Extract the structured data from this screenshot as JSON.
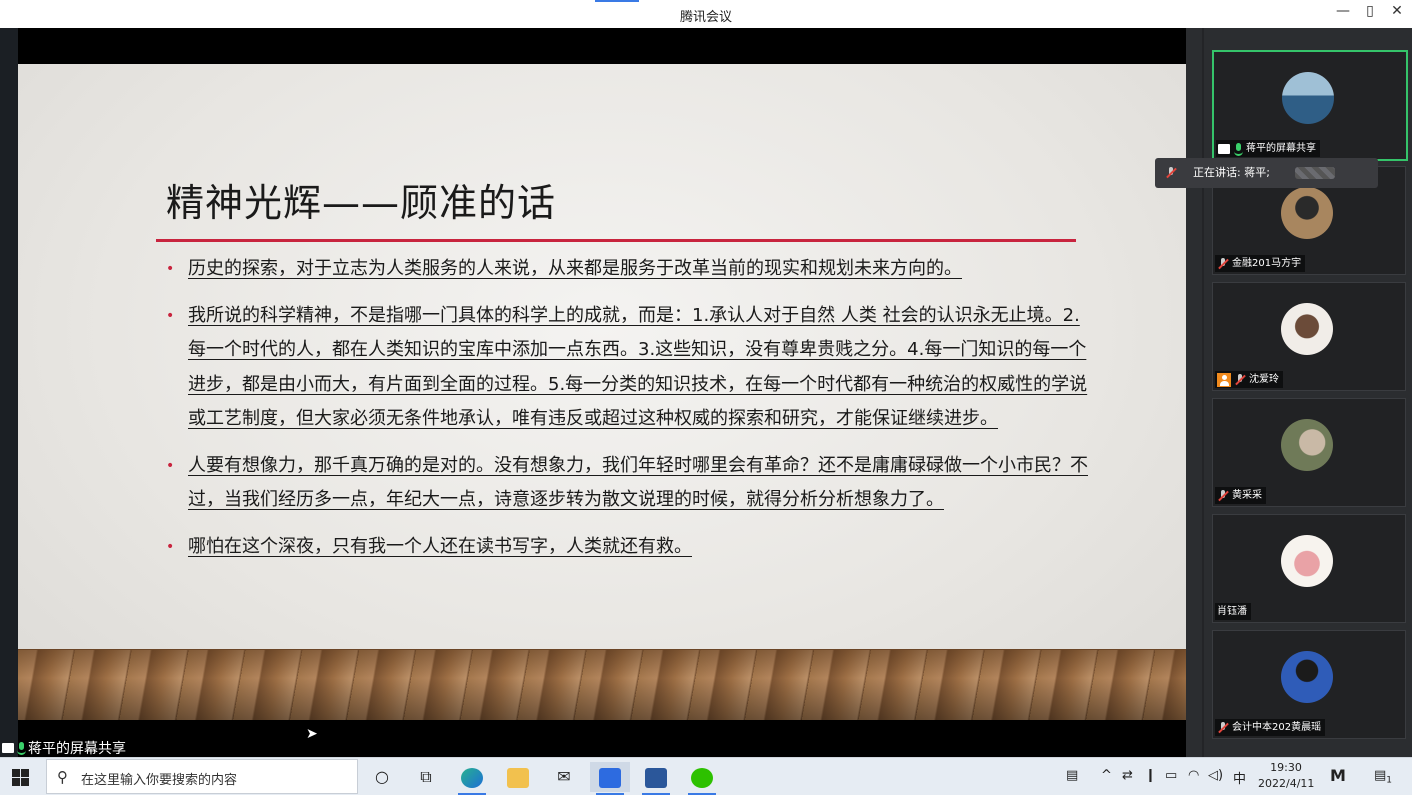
{
  "window": {
    "title": "腾讯会议",
    "minimize": "—",
    "restore": "▯",
    "close": "✕"
  },
  "slide": {
    "title": "精神光辉——顾准的话",
    "bullets": [
      "历史的探索，对于立志为人类服务的人来说，从来都是服务于改革当前的现实和规划未来方向的。",
      "我所说的科学精神，不是指哪一门具体的科学上的成就，而是：1.承认人对于自然 人类 社会的认识永无止境。2.每一个时代的人，都在人类知识的宝库中添加一点东西。3.这些知识，没有尊卑贵贱之分。4.每一门知识的每一个进步，都是由小而大，有片面到全面的过程。5.每一分类的知识技术，在每一个时代都有一种统治的权威性的学说或工艺制度，但大家必须无条件地承认，唯有违反或超过这种权威的探索和研究，才能保证继续进步。",
      "人要有想像力，那千真万确的是对的。没有想象力，我们年轻时哪里会有革命？还不是庸庸碌碌做一个小市民？不过，当我们经历多一点，年纪大一点，诗意逐步转为散文说理的时候，就得分析分析想象力了。",
      "哪怕在这个深夜，只有我一个人还在读书写字，人类就还有救。"
    ]
  },
  "share_label": "蒋平的屏幕共享",
  "speaking": {
    "text": "正在讲话: 蒋平;"
  },
  "participants": [
    {
      "name": "蒋平的屏幕共享",
      "icons": [
        "screen-icon",
        "mic-on-icon"
      ],
      "active": true,
      "avatar_colors": [
        "#2f5e86",
        "#9fc0d6"
      ]
    },
    {
      "name": "金融201马方宇",
      "icons": [
        "mic-off-icon"
      ],
      "active": false,
      "avatar_colors": [
        "#a8865f",
        "#2a2a2a"
      ]
    },
    {
      "name": "沈爱玲",
      "icons": [
        "person-icon",
        "mic-off-icon"
      ],
      "active": false,
      "avatar_colors": [
        "#f1ede8",
        "#6b4b39"
      ]
    },
    {
      "name": "黄采采",
      "icons": [
        "mic-off-icon"
      ],
      "active": false,
      "avatar_colors": [
        "#6f7a58",
        "#c9b9a6"
      ]
    },
    {
      "name": "肖钰潘",
      "icons": [],
      "active": false,
      "avatar_colors": [
        "#f7f3ee",
        "#e9a2a6"
      ]
    },
    {
      "name": "会计中本202黄晨瑶",
      "icons": [
        "mic-off-icon"
      ],
      "active": false,
      "avatar_colors": [
        "#2f5cb8",
        "#1b1b1b"
      ]
    }
  ],
  "taskbar": {
    "search_placeholder": "在这里输入你要搜索的内容",
    "time": "19:30",
    "date": "2022/4/11",
    "ime": "中",
    "notification_count": "1",
    "apps": [
      "cortana-icon",
      "task-view-icon",
      "edge-icon",
      "file-explorer-icon",
      "mail-icon",
      "tencent-meeting-icon",
      "word-icon",
      "wechat-icon"
    ]
  }
}
